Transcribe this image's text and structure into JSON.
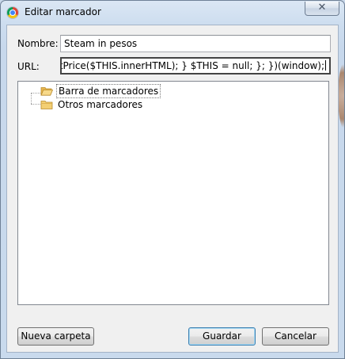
{
  "window": {
    "title": "Editar marcador",
    "close_glyph": "✕"
  },
  "form": {
    "name_label": "Nombre:",
    "name_value": "Steam in pesos",
    "url_label": "URL:",
    "url_value": "+ formatPrice($THIS.innerHTML); } $THIS = null; }; })(window);"
  },
  "tree": {
    "items": [
      {
        "label": "Barra de marcadores",
        "icon": "folder-open-icon",
        "selected": true
      },
      {
        "label": "Otros marcadores",
        "icon": "folder-icon",
        "selected": false
      }
    ]
  },
  "buttons": {
    "new_folder": "Nueva carpeta",
    "save": "Guardar",
    "cancel": "Cancelar"
  }
}
